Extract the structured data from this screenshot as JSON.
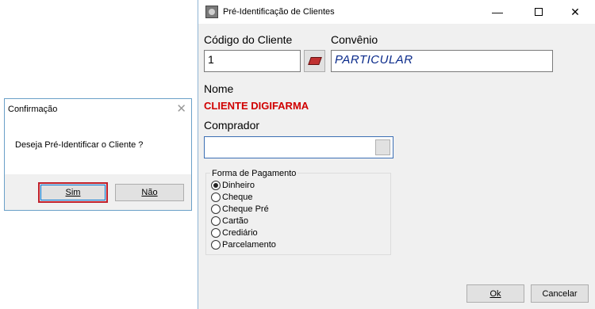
{
  "confirm": {
    "title": "Confirmação",
    "message": "Deseja Pré-Identificar o Cliente ?",
    "yes_label": "Sim",
    "no_label": "Não"
  },
  "window": {
    "title": "Pré-Identificação de Clientes",
    "codigo_label": "Código do Cliente",
    "codigo_value": "1",
    "convenio_label": "Convênio",
    "convenio_value": "PARTICULAR",
    "nome_label": "Nome",
    "nome_value": "CLIENTE DIGIFARMA",
    "comprador_label": "Comprador",
    "comprador_value": "",
    "pagamento": {
      "title": "Forma de Pagamento",
      "options": [
        "Dinheiro",
        "Cheque",
        "Cheque Pré",
        "Cartão",
        "Crediário",
        "Parcelamento"
      ],
      "selected": "Dinheiro"
    },
    "ok_label": "Ok",
    "cancel_label": "Cancelar"
  },
  "colors": {
    "name_red": "#d00000",
    "convenio_blue": "#0a2a8a",
    "focus_red": "#c0202c"
  }
}
